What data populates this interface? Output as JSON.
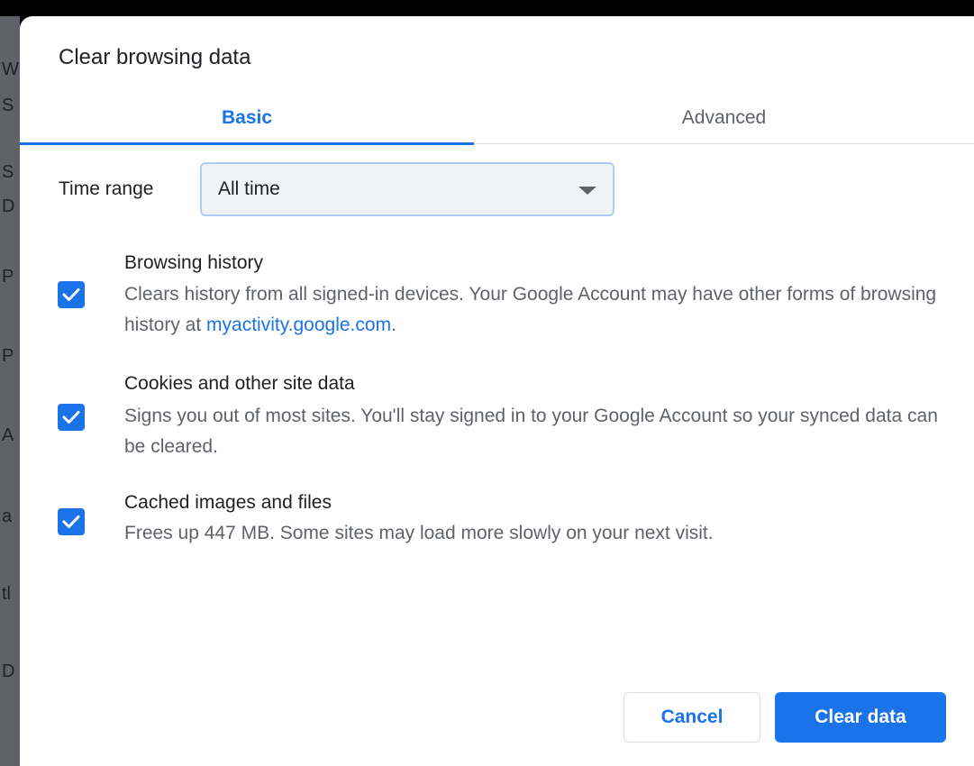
{
  "dialog": {
    "title": "Clear browsing data"
  },
  "tabs": [
    {
      "label": "Basic",
      "selected": true
    },
    {
      "label": "Advanced",
      "selected": false
    }
  ],
  "time_range": {
    "label": "Time range",
    "selected": "All time"
  },
  "options": [
    {
      "title": "Browsing history",
      "checked": true,
      "desc_before_link": "Clears history from all signed-in devices. Your Google Account may have other forms of browsing history at ",
      "link": "myactivity.google.com",
      "desc_after_link": "."
    },
    {
      "title": "Cookies and other site data",
      "checked": true,
      "desc": "Signs you out of most sites. You'll stay signed in to your Google Account so your synced data can be cleared."
    },
    {
      "title": "Cached images and files",
      "checked": true,
      "desc": "Frees up 447 MB. Some sites may load more slowly on your next visit."
    }
  ],
  "buttons": {
    "cancel": "Cancel",
    "clear": "Clear data"
  },
  "backdrop_chars": [
    "W",
    "S",
    "S",
    "D",
    "P",
    "P",
    "A",
    "a",
    "tl",
    "D"
  ],
  "colors": {
    "accent": "#1a73e8",
    "text_primary": "#202124",
    "text_secondary": "#5f6368"
  },
  "icons": {
    "checkbox": "checkmark-icon",
    "dropdown": "triangle-down-icon"
  }
}
